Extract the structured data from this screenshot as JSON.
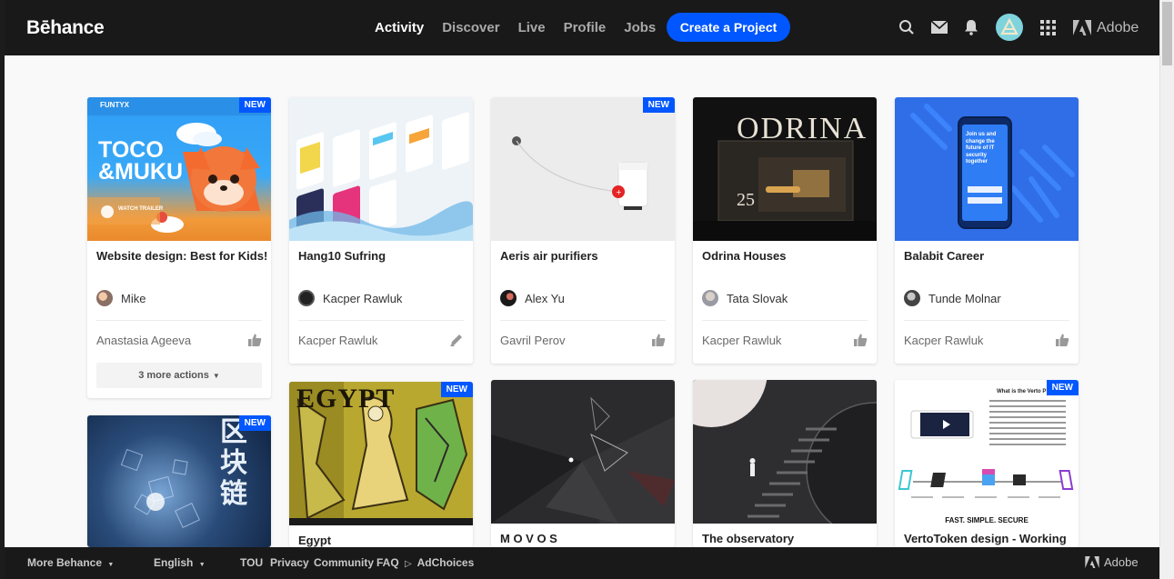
{
  "header": {
    "logo": "Bēhance",
    "nav": [
      "Activity",
      "Discover",
      "Live",
      "Profile",
      "Jobs"
    ],
    "create_button": "Create a Project",
    "adobe": "Adobe"
  },
  "badge_label": "NEW",
  "cards": [
    {
      "title": "Website design: Best for Kids!",
      "owner": "Mike",
      "by": "Anastasia Ageeva",
      "new": true,
      "action": "like-icon",
      "more_actions": "3 more actions",
      "thumb_text": [
        "FUNTYX",
        "TOCO",
        "&MUKU",
        "WATCH TRAILER"
      ]
    },
    {
      "title": "Hang10 Sufring",
      "owner": "Kacper Rawluk",
      "by": "Kacper Rawluk",
      "new": false,
      "action": "pencil-icon"
    },
    {
      "title": "Aeris air purifiers",
      "owner": "Alex Yu",
      "by": "Gavril Perov",
      "new": true,
      "action": "like-icon"
    },
    {
      "title": "Odrina Houses",
      "owner": "Tata Slovak",
      "by": "Kacper Rawluk",
      "new": false,
      "action": "like-icon",
      "thumb_text": [
        "ODRINA",
        "25"
      ]
    },
    {
      "title": "Balabit Career",
      "owner": "Tunde Molnar",
      "by": "Kacper Rawluk",
      "new": false,
      "action": "like-icon",
      "thumb_text": [
        "Join us and change the future of IT security together"
      ]
    },
    {
      "title": "",
      "new": true,
      "thumb_text": [
        "区",
        "块",
        "链"
      ]
    },
    {
      "title": "Egypt",
      "new": true,
      "thumb_text": [
        "EGYPT"
      ]
    },
    {
      "title": "M O V O S",
      "new": false
    },
    {
      "title": "The observatory",
      "new": false
    },
    {
      "title": "VertoToken design - Working",
      "new": true,
      "thumb_text": [
        "What is the Verto P",
        "FAST. SIMPLE. SECURE"
      ]
    }
  ],
  "footer": {
    "more": "More Behance",
    "language": "English",
    "links": [
      "TOU",
      "Privacy",
      "Community",
      "FAQ",
      "AdChoices"
    ],
    "adobe": "Adobe"
  },
  "colors": {
    "accent": "#0057ff",
    "header_bg": "#191919",
    "page_bg": "#f9f9f9"
  }
}
